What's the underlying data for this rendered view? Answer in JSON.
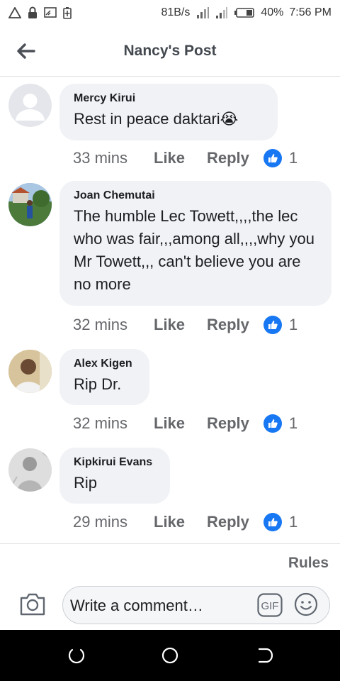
{
  "statusbar": {
    "speed": "81B/s",
    "battery": "40%",
    "time": "7:56 PM"
  },
  "header": {
    "title": "Nancy's Post"
  },
  "comments": [
    {
      "author": "Mercy Kirui",
      "text": "Rest in peace daktari😭",
      "time": "33 mins",
      "like": "Like",
      "reply": "Reply",
      "reactions": "1"
    },
    {
      "author": "Joan Chemutai",
      "text": "The humble Lec Towett,,,,the lec who was fair,,,among all,,,,why you Mr Towett,,, can't believe you are no more",
      "time": "32 mins",
      "like": "Like",
      "reply": "Reply",
      "reactions": "1"
    },
    {
      "author": "Alex Kigen",
      "text": "Rip Dr.",
      "time": "32 mins",
      "like": "Like",
      "reply": "Reply",
      "reactions": "1"
    },
    {
      "author": "Kipkirui Evans",
      "text": "Rip",
      "time": "29 mins",
      "like": "Like",
      "reply": "Reply",
      "reactions": "1"
    }
  ],
  "footer": {
    "rules": "Rules",
    "placeholder": "Write a comment…"
  },
  "colors": {
    "like_blue": "#1877f2",
    "bubble": "#f0f2f5",
    "meta": "#65676b"
  }
}
